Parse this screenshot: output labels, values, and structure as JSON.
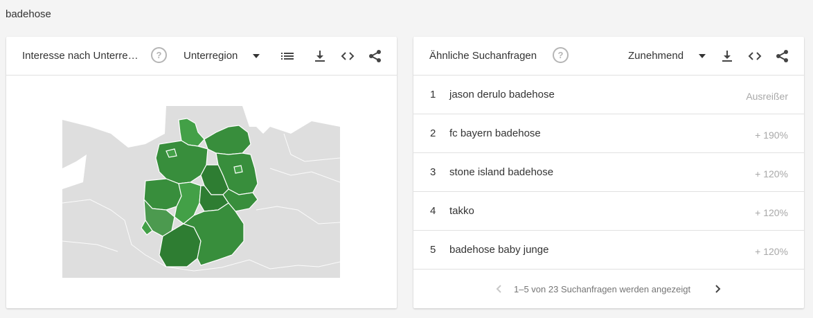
{
  "query": "badehose",
  "left_card": {
    "title": "Interesse nach Unterre…",
    "help_icon": "help-circle-icon",
    "select_value": "Unterregion",
    "icons": [
      "list-icon",
      "download-icon",
      "embed-code-icon",
      "share-icon"
    ],
    "map": {
      "country": "Deutschland",
      "land_color": "#dedede",
      "region_colors": [
        "#2e7d32",
        "#388e3c",
        "#43a047",
        "#4c9a4f"
      ]
    }
  },
  "right_card": {
    "title": "Ähnliche Suchanfragen",
    "help_icon": "help-circle-icon",
    "select_value": "Zunehmend",
    "icons": [
      "download-icon",
      "embed-code-icon",
      "share-icon"
    ],
    "rows": [
      {
        "rank": "1",
        "term": "jason derulo badehose",
        "value": "Ausreißer"
      },
      {
        "rank": "2",
        "term": "fc bayern badehose",
        "value": "+ 190%"
      },
      {
        "rank": "3",
        "term": "stone island badehose",
        "value": "+ 120%"
      },
      {
        "rank": "4",
        "term": "takko",
        "value": "+ 120%"
      },
      {
        "rank": "5",
        "term": "badehose baby junge",
        "value": "+ 120%"
      }
    ],
    "footer": "1–5 von 23 Suchanfragen werden angezeigt",
    "pager_icons": [
      "chevron-left-icon",
      "chevron-right-icon"
    ]
  },
  "colors": {
    "accent_green": "#388e3c",
    "muted_text": "#a8a8a8",
    "divider": "#e0e0e0"
  }
}
